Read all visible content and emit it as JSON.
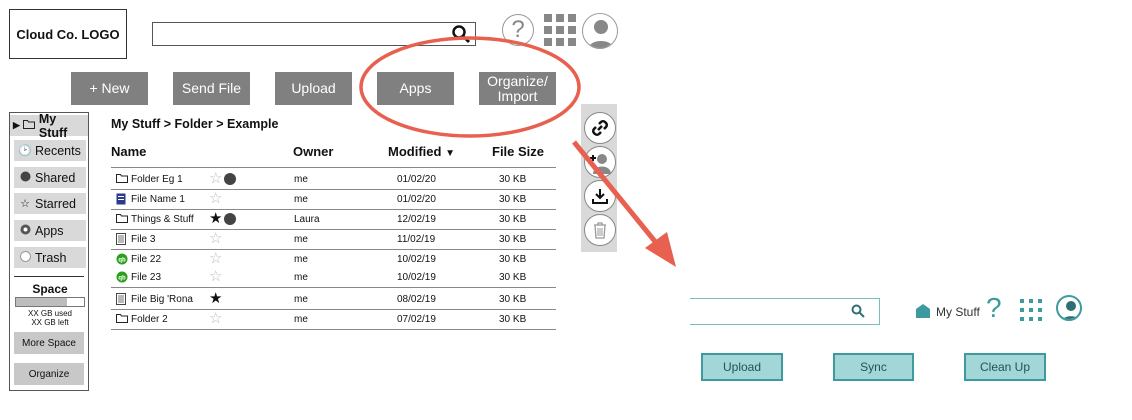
{
  "header": {
    "logo": "Cloud Co. LOGO",
    "search_placeholder": "",
    "help_glyph": "?"
  },
  "actions": {
    "new": "+ New",
    "send_file": "Send File",
    "upload": "Upload",
    "apps": "Apps",
    "organize": "Organize/ Import"
  },
  "nav": {
    "items": [
      {
        "label": "My Stuff",
        "icon": "folder-icon"
      },
      {
        "label": "Recents",
        "icon": "clock-icon"
      },
      {
        "label": "Shared",
        "icon": "shared-icon"
      },
      {
        "label": "Starred",
        "icon": "star-icon"
      },
      {
        "label": "Apps",
        "icon": "apps-icon"
      },
      {
        "label": "Trash",
        "icon": "trash-icon"
      }
    ],
    "space_title": "Space",
    "space_used_fraction": 0.75,
    "space_used": "XX GB used",
    "space_left": "XX GB left",
    "more_space": "More Space",
    "organize": "Organize"
  },
  "breadcrumb": "My Stuff > Folder > Example",
  "table": {
    "headers": {
      "name": "Name",
      "owner": "Owner",
      "modified": "Modified",
      "size": "File Size"
    },
    "sort_glyph": "▼",
    "rows": [
      {
        "name": "Folder Eg 1",
        "owner": "me",
        "modified": "01/02/20",
        "size": "30 KB",
        "starred": false,
        "shared": true,
        "icon": "folder-icon"
      },
      {
        "name": "File Name 1",
        "owner": "me",
        "modified": "01/02/20",
        "size": "30 KB",
        "starred": false,
        "shared": false,
        "icon": "doc-icon"
      },
      {
        "name": "Things & Stuff",
        "owner": "Laura",
        "modified": "12/02/19",
        "size": "30 KB",
        "starred": true,
        "shared": true,
        "icon": "folder-icon"
      },
      {
        "name": "File 3",
        "owner": "me",
        "modified": "11/02/19",
        "size": "30 KB",
        "starred": false,
        "shared": false,
        "icon": "text-file-icon"
      },
      {
        "name": "File 22",
        "owner": "me",
        "modified": "10/02/19",
        "size": "30 KB",
        "starred": false,
        "shared": false,
        "icon": "qb-icon"
      },
      {
        "name": "File 23",
        "owner": "me",
        "modified": "10/02/19",
        "size": "30 KB",
        "starred": false,
        "shared": false,
        "icon": "qb-icon"
      },
      {
        "name": "File Big 'Rona",
        "owner": "me",
        "modified": "08/02/19",
        "size": "30 KB",
        "starred": true,
        "shared": false,
        "icon": "text-file-icon"
      },
      {
        "name": "Folder 2",
        "owner": "me",
        "modified": "07/02/19",
        "size": "30 KB",
        "starred": false,
        "shared": false,
        "icon": "folder-icon"
      }
    ]
  },
  "tools": [
    "link-icon",
    "add-user-icon",
    "download-icon",
    "trash-icon"
  ],
  "mock": {
    "my_stuff": "My Stuff",
    "help_glyph": "?",
    "upload": "Upload",
    "sync": "Sync",
    "clean_up": "Clean Up"
  },
  "colors": {
    "button_gray": "#808080",
    "highlight": "#e8604f",
    "teal": "#3c9aa0",
    "teal_light": "#a3d6d6"
  }
}
